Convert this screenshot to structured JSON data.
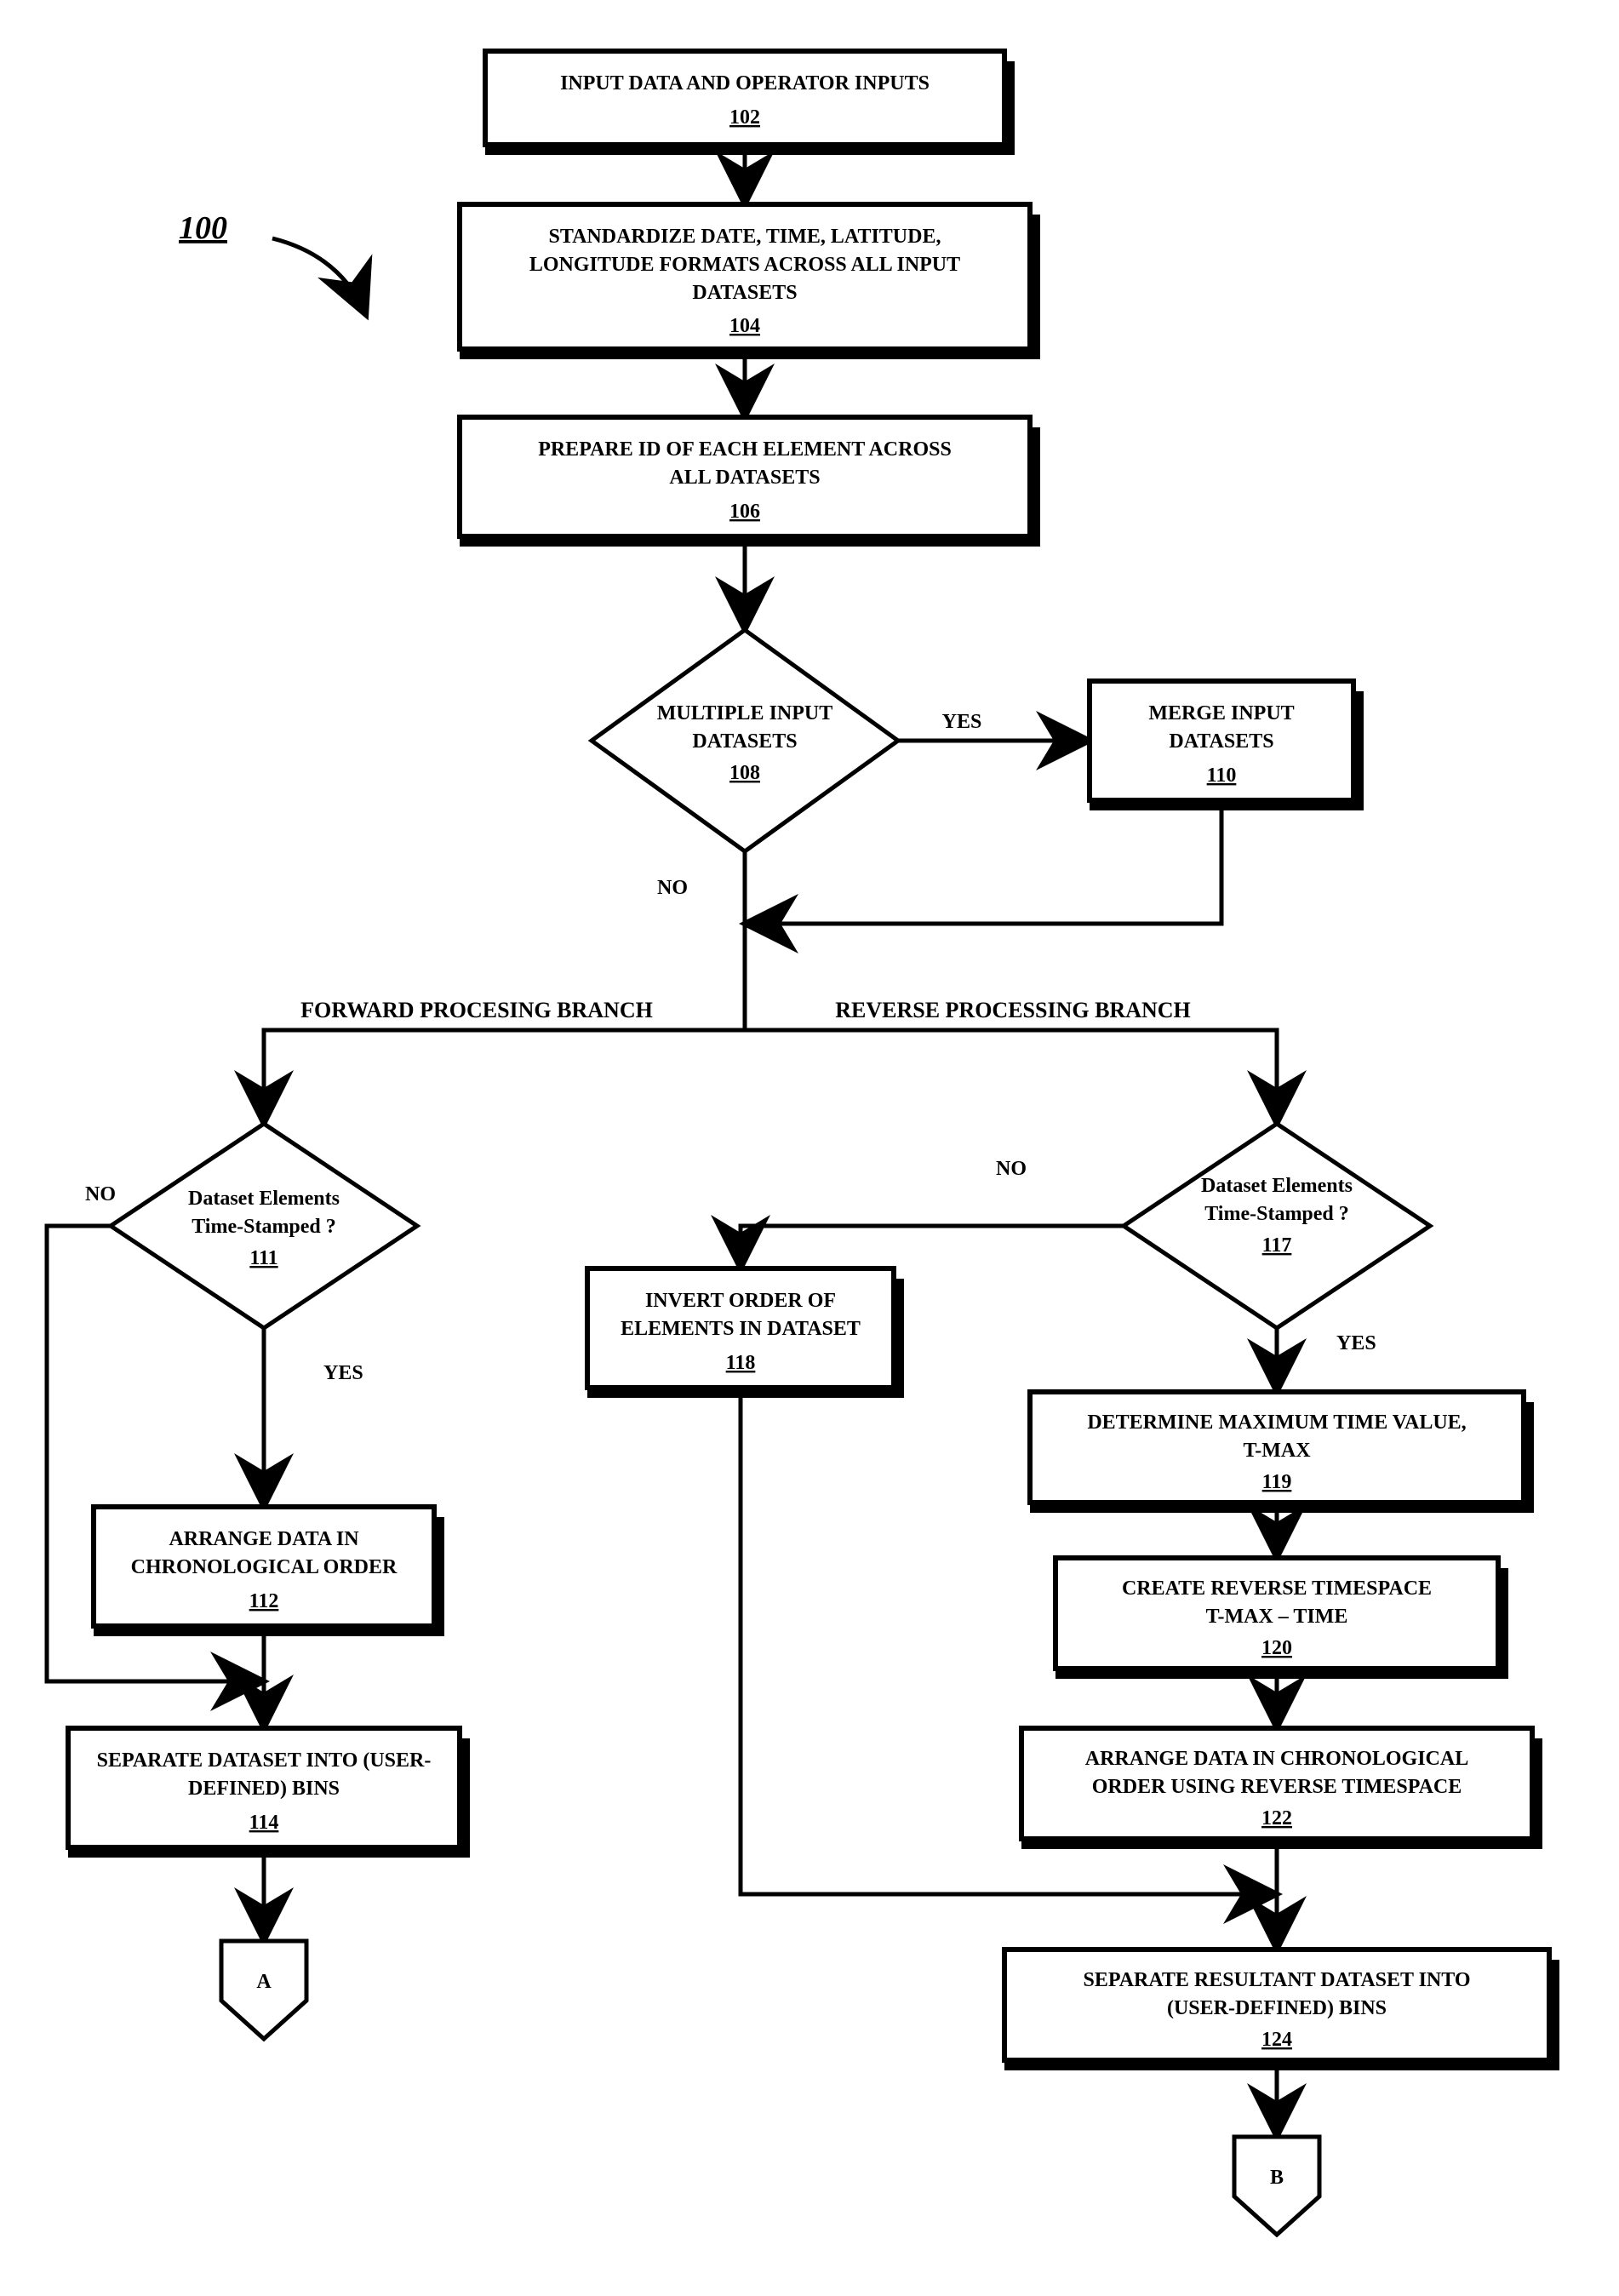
{
  "fig_ref": "100",
  "nodes": {
    "n102": {
      "lines": [
        "INPUT DATA AND OPERATOR INPUTS"
      ],
      "ref": "102"
    },
    "n104": {
      "lines": [
        "STANDARDIZE DATE, TIME, LATITUDE,",
        "LONGITUDE FORMATS ACROSS ALL INPUT",
        "DATASETS"
      ],
      "ref": "104"
    },
    "n106": {
      "lines": [
        "PREPARE ID OF EACH ELEMENT ACROSS",
        "ALL DATASETS"
      ],
      "ref": "106"
    },
    "n108": {
      "lines": [
        "MULTIPLE INPUT",
        "DATASETS"
      ],
      "ref": "108"
    },
    "n110": {
      "lines": [
        "MERGE INPUT",
        "DATASETS"
      ],
      "ref": "110"
    },
    "n111": {
      "lines": [
        "Dataset Elements",
        "Time-Stamped ?"
      ],
      "ref": "111"
    },
    "n112": {
      "lines": [
        "ARRANGE DATA IN",
        "CHRONOLOGICAL ORDER"
      ],
      "ref": "112"
    },
    "n114": {
      "lines": [
        "SEPARATE DATASET  INTO (USER-",
        "DEFINED) BINS"
      ],
      "ref": "114"
    },
    "n117": {
      "lines": [
        "Dataset Elements",
        "Time-Stamped ?"
      ],
      "ref": "117"
    },
    "n118": {
      "lines": [
        "INVERT ORDER OF",
        "ELEMENTS IN DATASET"
      ],
      "ref": "118"
    },
    "n119": {
      "lines": [
        "DETERMINE MAXIMUM TIME VALUE,",
        "T-MAX"
      ],
      "ref": "119"
    },
    "n120": {
      "lines": [
        "CREATE REVERSE TIMESPACE",
        "T-MAX – TIME"
      ],
      "ref": "120"
    },
    "n122": {
      "lines": [
        "ARRANGE DATA IN CHRONOLOGICAL",
        "ORDER USING REVERSE TIMESPACE"
      ],
      "ref": "122"
    },
    "n124": {
      "lines": [
        "SEPARATE RESULTANT DATASET  INTO",
        "(USER-DEFINED) BINS"
      ],
      "ref": "124"
    }
  },
  "labels": {
    "yes": "YES",
    "no": "NO",
    "forward": "FORWARD  PROCESING BRANCH",
    "reverse": "REVERSE PROCESSING BRANCH",
    "connA": "A",
    "connB": "B"
  }
}
